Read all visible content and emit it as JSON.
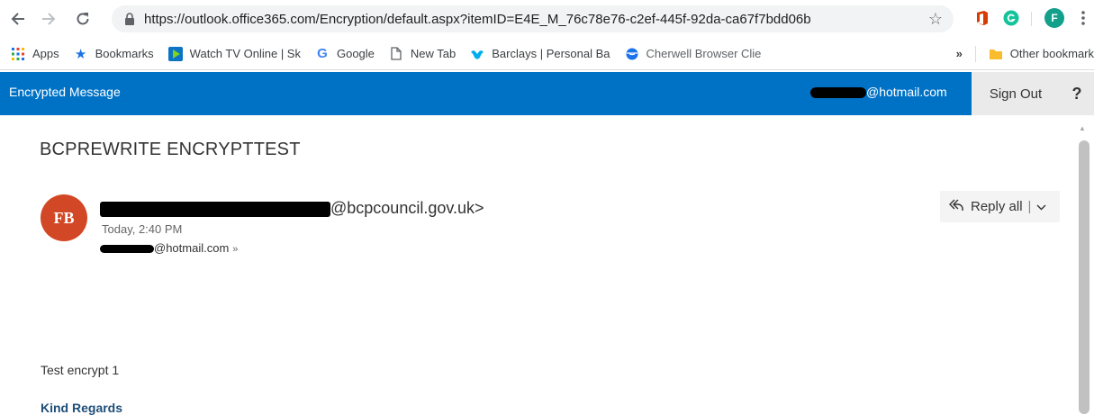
{
  "browser": {
    "url_full": "https://outlook.office365.com/Encryption/default.aspx?itemID=E4E_M_76c78e76-c2ef-445f-92da-ca67f7bdd06b",
    "profile_initial": "F"
  },
  "bookmarks": {
    "items": [
      {
        "label": "Apps",
        "icon": "apps-grid-icon"
      },
      {
        "label": "Bookmarks",
        "icon": "star-icon"
      },
      {
        "label": "Watch TV Online | Sk",
        "icon": "play-icon"
      },
      {
        "label": "Google",
        "icon": "google-icon"
      },
      {
        "label": "New Tab",
        "icon": "page-icon"
      },
      {
        "label": "Barclays | Personal Ba",
        "icon": "eagle-icon"
      },
      {
        "label": "Cherwell Browser Clie",
        "icon": "globe-icon"
      }
    ],
    "overflow": "»",
    "other": "Other bookmark"
  },
  "header": {
    "title": "Encrypted Message",
    "user_suffix": "@hotmail.com",
    "sign_out": "Sign Out",
    "help": "?"
  },
  "message": {
    "subject": "BCPREWRITE ENCRYPTTEST",
    "avatar_initials": "FB",
    "sender_suffix": "@bcpcouncil.gov.uk>",
    "time": "Today, 2:40 PM",
    "recipient_suffix": "@hotmail.com",
    "reply_all": "Reply all",
    "body_line1": "Test encrypt 1",
    "body_line2": "Kind Regards"
  },
  "colors": {
    "header_blue": "#0072c6",
    "avatar_red": "#d24726"
  }
}
